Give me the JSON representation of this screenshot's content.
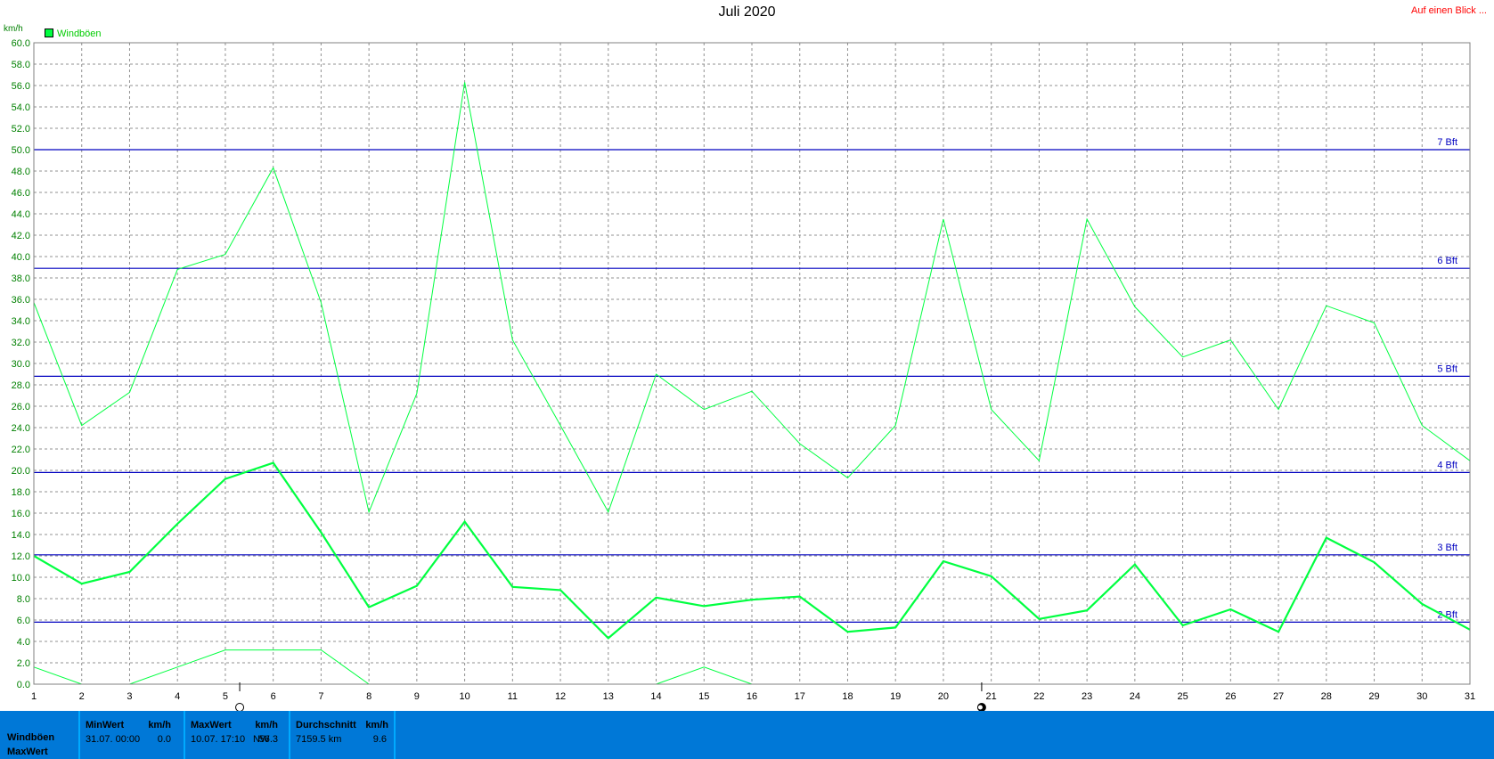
{
  "header": {
    "title": "Juli 2020",
    "link": "Auf einen Blick ..."
  },
  "chart_data": {
    "type": "line",
    "title": "Juli 2020",
    "ylabel": "km/h",
    "xlim": [
      1,
      31
    ],
    "ylim": [
      0,
      60
    ],
    "grid": true,
    "legend": {
      "position": "top-left",
      "entries": [
        "Windböen"
      ]
    },
    "x": [
      1,
      2,
      3,
      4,
      5,
      6,
      7,
      8,
      9,
      10,
      11,
      12,
      13,
      14,
      15,
      16,
      17,
      18,
      19,
      20,
      21,
      22,
      23,
      24,
      25,
      26,
      27,
      28,
      29,
      30,
      31
    ],
    "series": [
      {
        "name": "Windböen",
        "role": "max",
        "values": [
          35.7,
          24.2,
          27.3,
          38.8,
          40.2,
          48.3,
          35.7,
          16.1,
          27.2,
          56.3,
          32.2,
          24.2,
          16.1,
          29.0,
          25.7,
          27.4,
          22.5,
          19.3,
          24.2,
          43.5,
          25.7,
          20.9,
          43.5,
          35.3,
          30.6,
          32.2,
          25.7,
          35.4,
          33.8,
          24.2,
          20.9
        ],
        "color": "#00ff40"
      },
      {
        "name": "Windböen",
        "role": "avg",
        "values": [
          12.0,
          9.4,
          10.5,
          15.0,
          19.2,
          20.7,
          14.2,
          7.2,
          9.2,
          15.2,
          9.1,
          8.8,
          4.3,
          8.1,
          7.3,
          7.9,
          8.2,
          4.9,
          5.3,
          11.5,
          10.1,
          6.1,
          6.9,
          11.2,
          5.5,
          7.0,
          4.9,
          13.7,
          11.4,
          7.5,
          5.1
        ],
        "color": "#00ff40"
      },
      {
        "name": "Windböen",
        "role": "min",
        "values": [
          1.6,
          0.0,
          0.0,
          1.6,
          3.2,
          3.2,
          3.2,
          0.0,
          null,
          null,
          null,
          null,
          null,
          0.0,
          1.6,
          0.0,
          null,
          null,
          null,
          null,
          null,
          null,
          null,
          null,
          null,
          null,
          null,
          null,
          null,
          null,
          null
        ],
        "color": "#00ff40"
      }
    ],
    "reference_lines": [
      {
        "label": "2 Bft",
        "y": 5.8
      },
      {
        "label": "3 Bft",
        "y": 12.1
      },
      {
        "label": "4 Bft",
        "y": 19.8
      },
      {
        "label": "5 Bft",
        "y": 28.8
      },
      {
        "label": "6 Bft",
        "y": 38.9
      },
      {
        "label": "7 Bft",
        "y": 50.0
      }
    ],
    "moon_markers": [
      {
        "day": 5.3,
        "phase": "full"
      },
      {
        "day": 20.8,
        "phase": "new"
      }
    ]
  },
  "footer": {
    "row_label_1": "Windböen",
    "row_label_2": "MaxWert",
    "min": {
      "header": "MinWert",
      "unit": "km/h",
      "date": "31.07.  00:00",
      "value": "0.0"
    },
    "max": {
      "header": "MaxWert",
      "unit": "km/h",
      "date": "10.07.  17:10",
      "dir": "NW",
      "value": "56.3"
    },
    "avg": {
      "header": "Durchschnitt",
      "unit": "km/h",
      "dist": "7159.5 km",
      "value": "9.6"
    }
  }
}
